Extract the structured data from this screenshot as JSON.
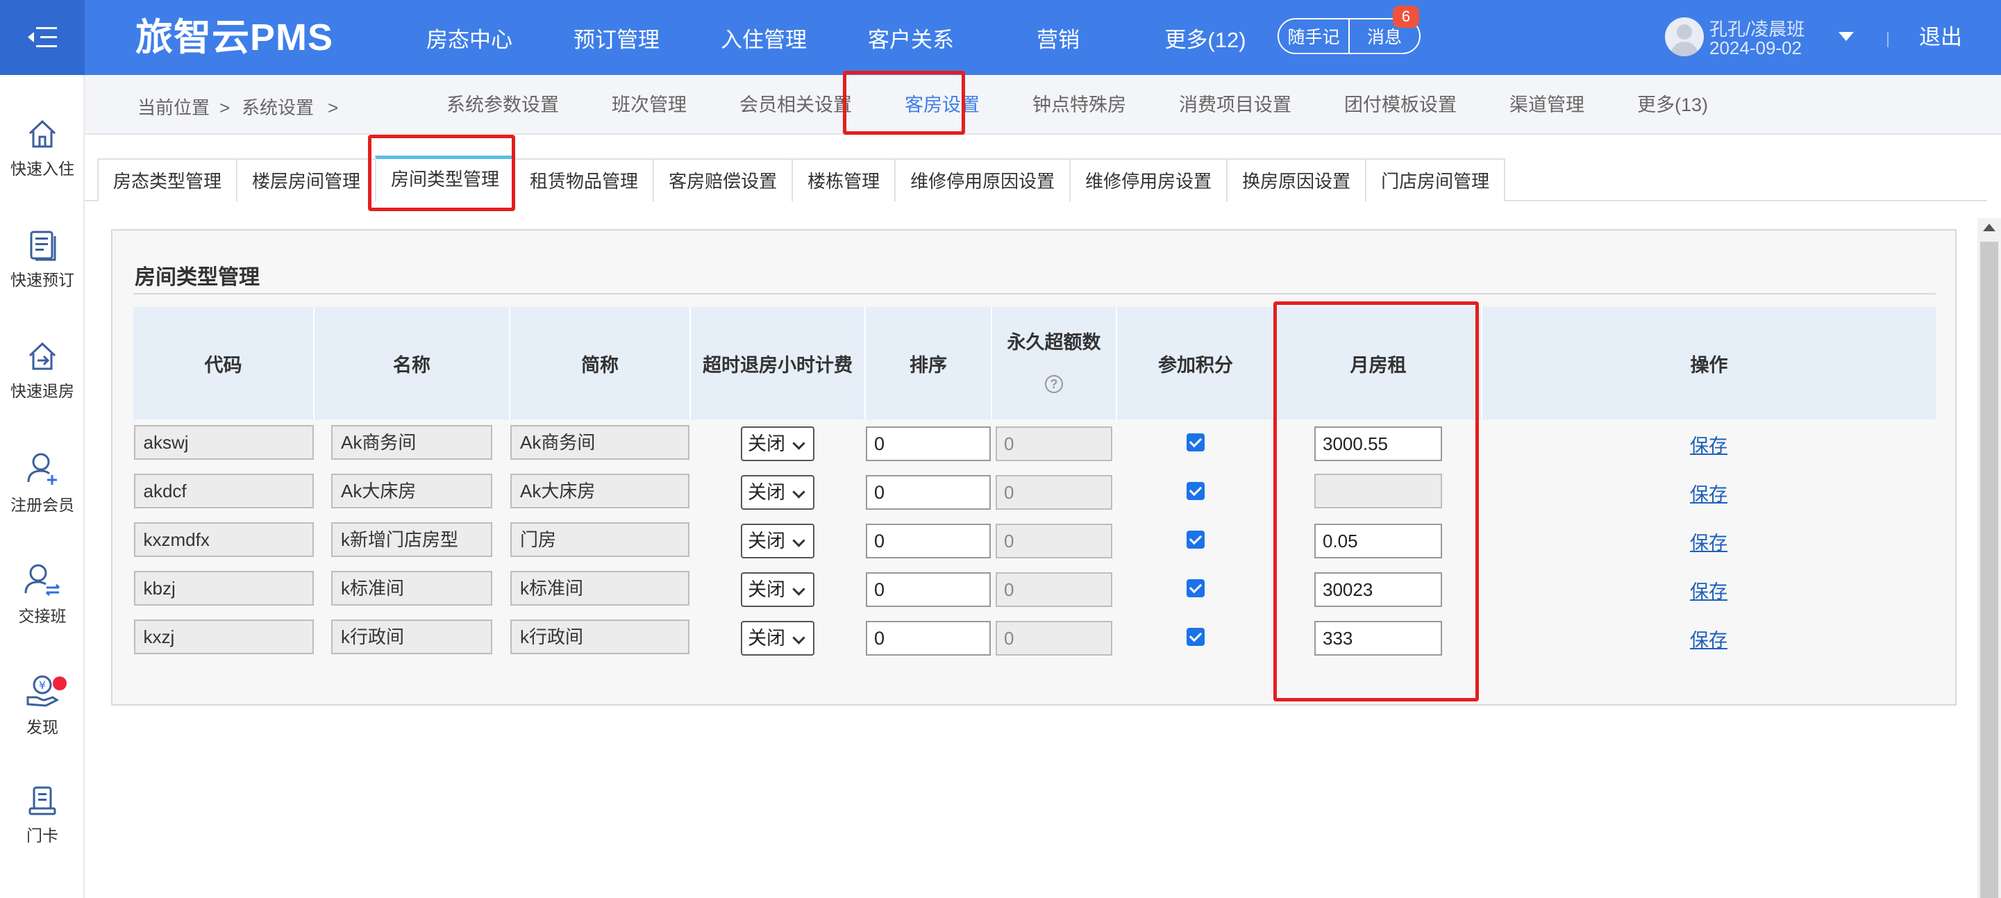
{
  "app": {
    "logo": "旅智云PMS"
  },
  "top_nav": [
    "房态中心",
    "预订管理",
    "入住管理",
    "客户关系",
    "营销",
    "更多(12)"
  ],
  "top_tools": {
    "memo": "随手记",
    "messages": "消息",
    "message_count": "6"
  },
  "user": {
    "name": "孔孔/凌晨班",
    "date": "2024-09-02",
    "logout": "退出"
  },
  "sidebar": [
    {
      "label": "快速入住",
      "icon": "home-enter-icon"
    },
    {
      "label": "快速预订",
      "icon": "booking-list-icon"
    },
    {
      "label": "快速退房",
      "icon": "home-exit-icon"
    },
    {
      "label": "注册会员",
      "icon": "add-member-icon"
    },
    {
      "label": "交接班",
      "icon": "shift-handover-icon"
    },
    {
      "label": "发现",
      "icon": "discover-money-icon"
    },
    {
      "label": "门卡",
      "icon": "room-card-icon"
    }
  ],
  "breadcrumb": {
    "current": "当前位置",
    "sep": ">",
    "section": "系统设置",
    "sep2": ">"
  },
  "sub_nav": [
    "系统参数设置",
    "班次管理",
    "会员相关设置",
    "客房设置",
    "钟点特殊房",
    "消费项目设置",
    "团付模板设置",
    "渠道管理",
    "更多(13)"
  ],
  "sub_nav_active": "客房设置",
  "tabs": [
    "房态类型管理",
    "楼层房间管理",
    "房间类型管理",
    "租赁物品管理",
    "客房赔偿设置",
    "楼栋管理",
    "维修停用原因设置",
    "维修停用房设置",
    "换房原因设置",
    "门店房间管理"
  ],
  "tab_active": "房间类型管理",
  "panel": {
    "title": "房间类型管理"
  },
  "table": {
    "headers": [
      "代码",
      "名称",
      "简称",
      "超时退房小时计费",
      "排序",
      "永久超额数",
      "参加积分",
      "月房租",
      "操作"
    ],
    "help_icon": "?",
    "rows": [
      {
        "code": "akswj",
        "name": "Ak商务间",
        "short": "Ak商务间",
        "overtime": "关闭",
        "sort": "0",
        "permanent": "0",
        "points": true,
        "rent": "3000.55",
        "action": "保存"
      },
      {
        "code": "akdcf",
        "name": "Ak大床房",
        "short": "Ak大床房",
        "overtime": "关闭",
        "sort": "0",
        "permanent": "0",
        "points": true,
        "rent": "",
        "action": "保存"
      },
      {
        "code": "kxzmdfx",
        "name": "k新增门店房型",
        "short": "门房",
        "overtime": "关闭",
        "sort": "0",
        "permanent": "0",
        "points": true,
        "rent": "0.05",
        "action": "保存"
      },
      {
        "code": "kbzj",
        "name": "k标准间",
        "short": "k标准间",
        "overtime": "关闭",
        "sort": "0",
        "permanent": "0",
        "points": true,
        "rent": "30023",
        "action": "保存"
      },
      {
        "code": "kxzj",
        "name": "k行政间",
        "short": "k行政间",
        "overtime": "关闭",
        "sort": "0",
        "permanent": "0",
        "points": true,
        "rent": "333",
        "action": "保存"
      }
    ]
  },
  "colors": {
    "topbar": "#3f7ee8",
    "accent": "#3f7ee8",
    "highlight": "#e41e1e",
    "checkbox": "#1a73e8"
  }
}
